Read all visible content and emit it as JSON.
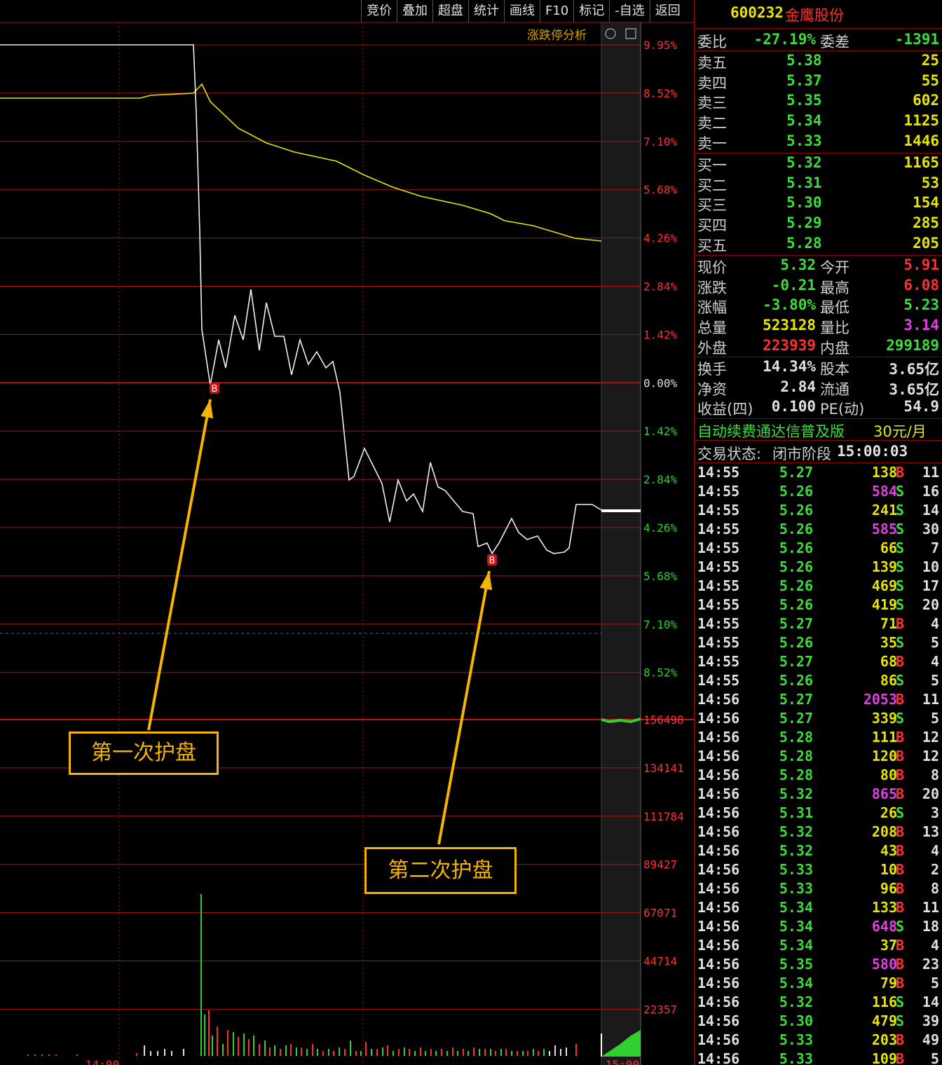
{
  "toolbar": [
    "竞价",
    "叠加",
    "超盘",
    "统计",
    "画线",
    "F10",
    "标记",
    "-自选",
    "返回"
  ],
  "chart": {
    "panel_title": "涨跌停分析",
    "price_axis": [
      "9.95%",
      "8.52%",
      "7.10%",
      "5.68%",
      "4.26%",
      "2.84%",
      "1.42%",
      "0.00%",
      "1.42%",
      "2.84%",
      "4.26%",
      "5.68%",
      "7.10%",
      "8.52%"
    ],
    "volume_axis": [
      "156498",
      "134141",
      "111784",
      "89427",
      "67071",
      "44714",
      "22357"
    ],
    "time_labels": [
      "14:00",
      "15:00"
    ],
    "buy_marker": "B",
    "annotations": [
      "第一次护盘",
      "第二次护盘"
    ],
    "colors": {
      "grid": "#b01010",
      "price_line": "#f0f0f0",
      "avg_line": "#e6e600",
      "up": "#ff3030",
      "down": "#30d030",
      "accent": "#f5b400"
    }
  },
  "quote": {
    "code": "600232",
    "name": "金鹰股份",
    "weibi_label": "委比",
    "weibi": "-27.19%",
    "weicha_label": "委差",
    "weicha": "-1391",
    "asks": [
      {
        "label": "卖五",
        "price": "5.38",
        "vol": "25"
      },
      {
        "label": "卖四",
        "price": "5.37",
        "vol": "55"
      },
      {
        "label": "卖三",
        "price": "5.35",
        "vol": "602"
      },
      {
        "label": "卖二",
        "price": "5.34",
        "vol": "1125"
      },
      {
        "label": "卖一",
        "price": "5.33",
        "vol": "1446"
      }
    ],
    "bids": [
      {
        "label": "买一",
        "price": "5.32",
        "vol": "1165"
      },
      {
        "label": "买二",
        "price": "5.31",
        "vol": "53"
      },
      {
        "label": "买三",
        "price": "5.30",
        "vol": "154"
      },
      {
        "label": "买四",
        "price": "5.29",
        "vol": "285"
      },
      {
        "label": "买五",
        "price": "5.28",
        "vol": "205"
      }
    ],
    "stats": [
      {
        "l1": "现价",
        "v1": "5.32",
        "c1": "g",
        "l2": "今开",
        "v2": "5.91",
        "c2": "r"
      },
      {
        "l1": "涨跌",
        "v1": "-0.21",
        "c1": "g",
        "l2": "最高",
        "v2": "6.08",
        "c2": "r"
      },
      {
        "l1": "涨幅",
        "v1": "-3.80%",
        "c1": "g",
        "l2": "最低",
        "v2": "5.23",
        "c2": "g"
      },
      {
        "l1": "总量",
        "v1": "523128",
        "c1": "y",
        "l2": "量比",
        "v2": "3.14",
        "c2": "m"
      },
      {
        "l1": "外盘",
        "v1": "223939",
        "c1": "r",
        "l2": "内盘",
        "v2": "299189",
        "c2": "g"
      }
    ],
    "stats2": [
      {
        "l1": "换手",
        "v1": "14.34%",
        "l2": "股本",
        "v2": "3.65亿"
      },
      {
        "l1": "净资",
        "v1": "2.84",
        "l2": "流通",
        "v2": "3.65亿"
      },
      {
        "l1": "收益(四)",
        "v1": "0.100",
        "l2": "PE(动)",
        "v2": "54.9"
      }
    ],
    "ad": "自动续费通达信普及版",
    "ad_price": "30元/月",
    "status_label": "交易状态:",
    "status": "闭市阶段",
    "status_time": "15:00:03"
  },
  "ticks": [
    [
      "14:55",
      "5.27",
      "138",
      "B",
      "11"
    ],
    [
      "14:55",
      "5.26",
      "584",
      "S",
      "16"
    ],
    [
      "14:55",
      "5.26",
      "241",
      "S",
      "14"
    ],
    [
      "14:55",
      "5.26",
      "585",
      "S",
      "30"
    ],
    [
      "14:55",
      "5.26",
      "66",
      "S",
      "7"
    ],
    [
      "14:55",
      "5.26",
      "139",
      "S",
      "10"
    ],
    [
      "14:55",
      "5.26",
      "469",
      "S",
      "17"
    ],
    [
      "14:55",
      "5.26",
      "419",
      "S",
      "20"
    ],
    [
      "14:55",
      "5.27",
      "71",
      "B",
      "4"
    ],
    [
      "14:55",
      "5.26",
      "35",
      "S",
      "5"
    ],
    [
      "14:55",
      "5.27",
      "68",
      "B",
      "4"
    ],
    [
      "14:55",
      "5.26",
      "86",
      "S",
      "5"
    ],
    [
      "14:56",
      "5.27",
      "2053",
      "B",
      "11"
    ],
    [
      "14:56",
      "5.27",
      "339",
      "S",
      "5"
    ],
    [
      "14:56",
      "5.28",
      "111",
      "B",
      "12"
    ],
    [
      "14:56",
      "5.28",
      "120",
      "B",
      "12"
    ],
    [
      "14:56",
      "5.28",
      "80",
      "B",
      "8"
    ],
    [
      "14:56",
      "5.32",
      "865",
      "B",
      "20"
    ],
    [
      "14:56",
      "5.31",
      "26",
      "S",
      "3"
    ],
    [
      "14:56",
      "5.32",
      "208",
      "B",
      "13"
    ],
    [
      "14:56",
      "5.32",
      "43",
      "B",
      "4"
    ],
    [
      "14:56",
      "5.33",
      "10",
      "B",
      "2"
    ],
    [
      "14:56",
      "5.33",
      "96",
      "B",
      "8"
    ],
    [
      "14:56",
      "5.34",
      "133",
      "B",
      "11"
    ],
    [
      "14:56",
      "5.34",
      "648",
      "S",
      "18"
    ],
    [
      "14:56",
      "5.34",
      "37",
      "B",
      "4"
    ],
    [
      "14:56",
      "5.35",
      "580",
      "B",
      "23"
    ],
    [
      "14:56",
      "5.34",
      "79",
      "B",
      "5"
    ],
    [
      "14:56",
      "5.32",
      "116",
      "S",
      "14"
    ],
    [
      "14:56",
      "5.30",
      "479",
      "S",
      "39"
    ],
    [
      "14:56",
      "5.33",
      "203",
      "B",
      "49"
    ],
    [
      "14:56",
      "5.33",
      "109",
      "B",
      "5"
    ]
  ]
}
